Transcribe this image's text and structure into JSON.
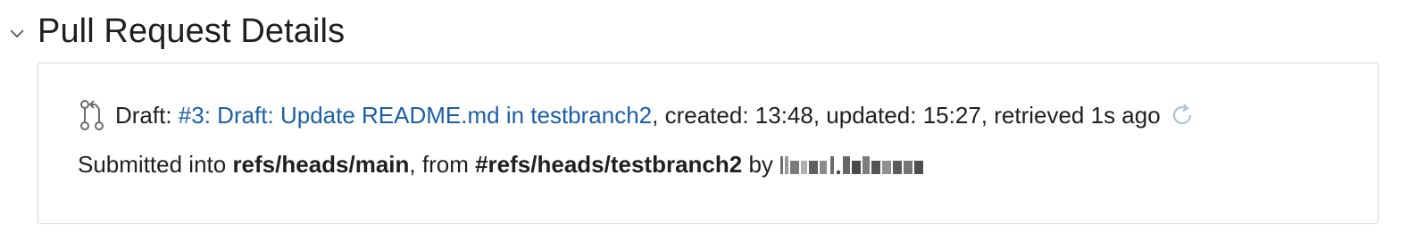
{
  "section": {
    "title": "Pull Request Details"
  },
  "pr": {
    "status_prefix": "Draft: ",
    "link_text": "#3: Draft: Update README.md in testbranch2",
    "meta": ", created: 13:48, updated: 15:27, retrieved 1s ago",
    "submitted_prefix": "Submitted into ",
    "target_ref": "refs/heads/main",
    "from_text": ", from ",
    "source_ref": "#refs/heads/testbranch2",
    "by_text": " by"
  },
  "icons": {
    "collapse": "chevron-down-icon",
    "pull_request": "git-pull-request-icon",
    "refresh": "refresh-icon"
  },
  "colors": {
    "link": "#1a5fa8",
    "refresh": "#a9c4dc",
    "border": "#d8d8d8"
  }
}
